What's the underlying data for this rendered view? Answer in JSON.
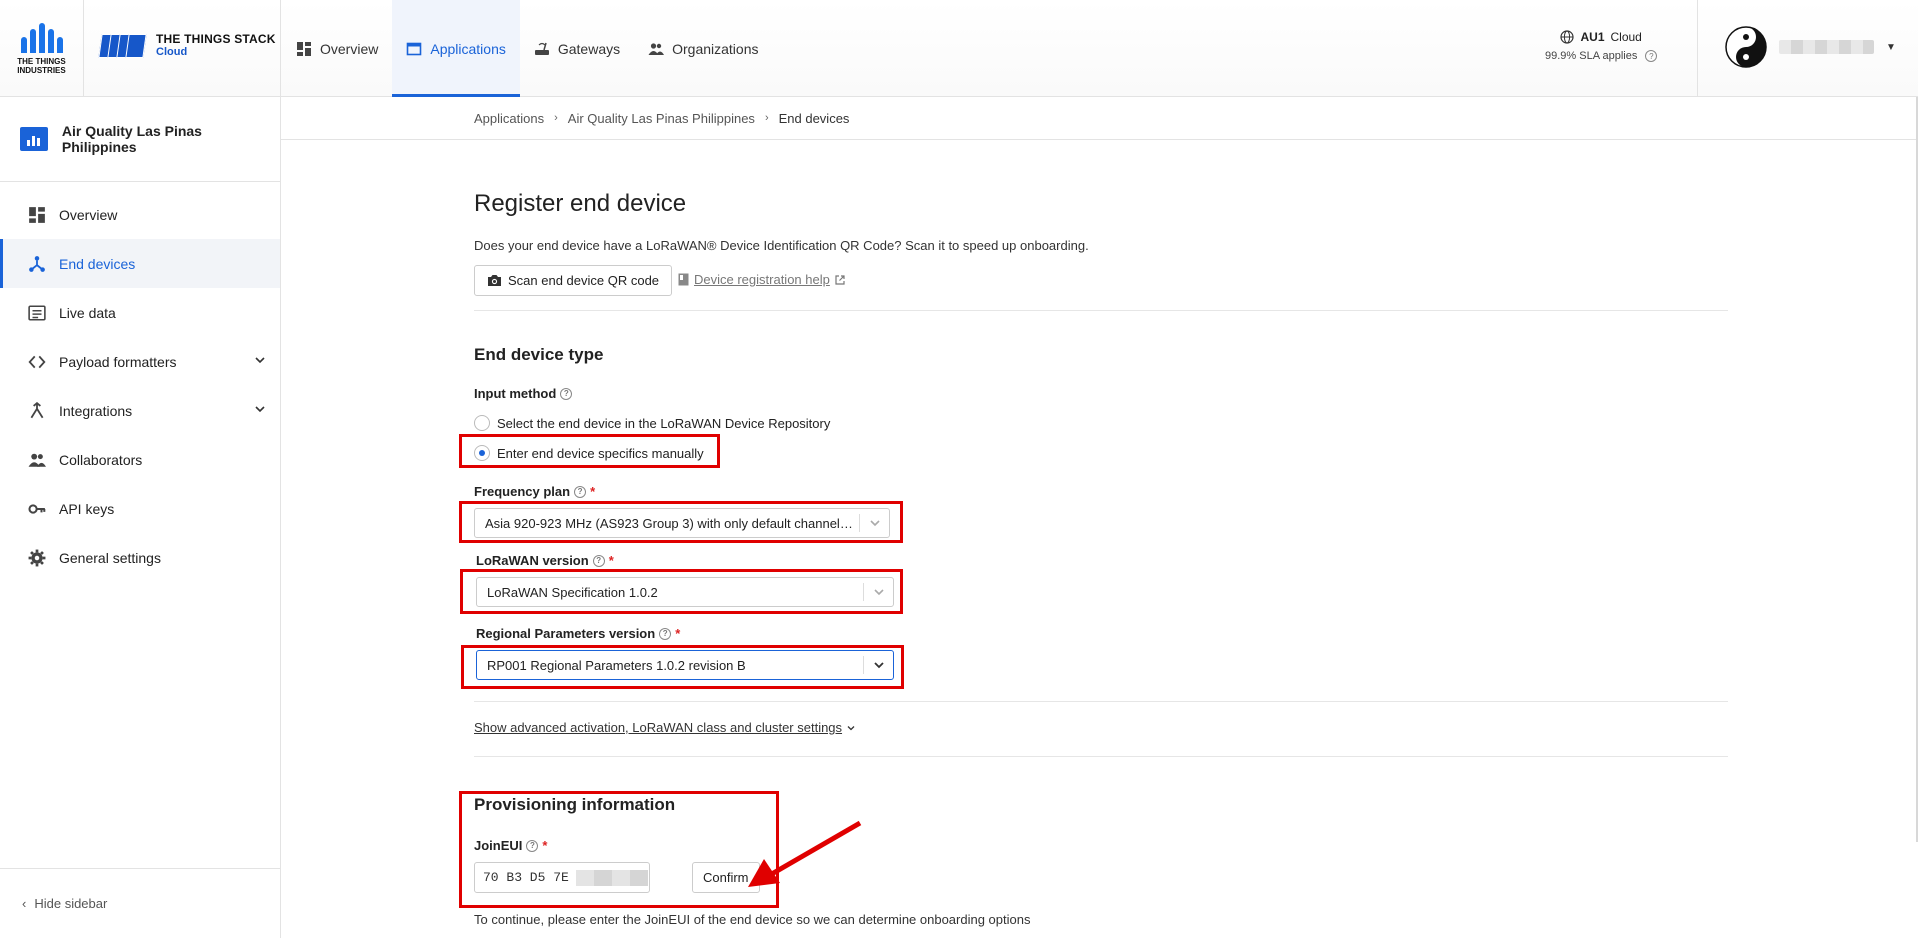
{
  "logos": {
    "tti_text_line1": "THE THINGS",
    "tti_text_line2": "INDUSTRIES",
    "tts_title": "THE THINGS STACK",
    "tts_subtitle": "Cloud"
  },
  "topnav": [
    {
      "label": "Overview",
      "icon": "dashboard-icon",
      "active": false
    },
    {
      "label": "Applications",
      "icon": "application-window-icon",
      "active": true
    },
    {
      "label": "Gateways",
      "icon": "gateway-router-icon",
      "active": false
    },
    {
      "label": "Organizations",
      "icon": "people-group-icon",
      "active": false
    }
  ],
  "region": {
    "code": "AU1",
    "name": "Cloud",
    "sla": "99.9% SLA applies"
  },
  "sidebar": {
    "app_name": "Air Quality Las Pinas Philippines",
    "items": [
      {
        "label": "Overview",
        "icon": "dashboard-icon",
        "active": false,
        "expandable": false
      },
      {
        "label": "End devices",
        "icon": "device-hub-icon",
        "active": true,
        "expandable": false
      },
      {
        "label": "Live data",
        "icon": "list-data-icon",
        "active": false,
        "expandable": false
      },
      {
        "label": "Payload formatters",
        "icon": "code-brackets-icon",
        "active": false,
        "expandable": true
      },
      {
        "label": "Integrations",
        "icon": "merge-integration-icon",
        "active": false,
        "expandable": true
      },
      {
        "label": "Collaborators",
        "icon": "people-group-icon",
        "active": false,
        "expandable": false
      },
      {
        "label": "API keys",
        "icon": "key-icon",
        "active": false,
        "expandable": false
      },
      {
        "label": "General settings",
        "icon": "gear-icon",
        "active": false,
        "expandable": false
      }
    ],
    "hide_label": "Hide sidebar"
  },
  "breadcrumb": [
    "Applications",
    "Air Quality Las Pinas Philippines",
    "End devices"
  ],
  "main": {
    "title": "Register end device",
    "qr_description": "Does your end device have a LoRaWAN® Device Identification QR Code? Scan it to speed up onboarding.",
    "scan_button": "Scan end device QR code",
    "help_link": "Device registration help",
    "device_type": {
      "heading": "End device type",
      "input_method_label": "Input method",
      "options": [
        {
          "label": "Select the end device in the LoRaWAN Device Repository",
          "checked": false
        },
        {
          "label": "Enter end device specifics manually",
          "checked": true
        }
      ],
      "frequency_plan_label": "Frequency plan",
      "frequency_plan_value": "Asia 920-923 MHz (AS923 Group 3) with only default channels a...",
      "lorawan_version_label": "LoRaWAN version",
      "lorawan_version_value": "LoRaWAN Specification 1.0.2",
      "regional_params_label": "Regional Parameters version",
      "regional_params_value": "RP001 Regional Parameters 1.0.2 revision B",
      "advanced_link": "Show advanced activation, LoRaWAN class and cluster settings"
    },
    "provisioning": {
      "heading": "Provisioning information",
      "joineui_label": "JoinEUI",
      "joineui_value": "70 B3 D5 7E",
      "confirm_button": "Confirm",
      "continue_text": "To continue, please enter the JoinEUI of the end device so we can determine onboarding options"
    }
  },
  "colors": {
    "accent": "#1a63d8",
    "highlight": "#e00000",
    "required": "#dd2222"
  }
}
